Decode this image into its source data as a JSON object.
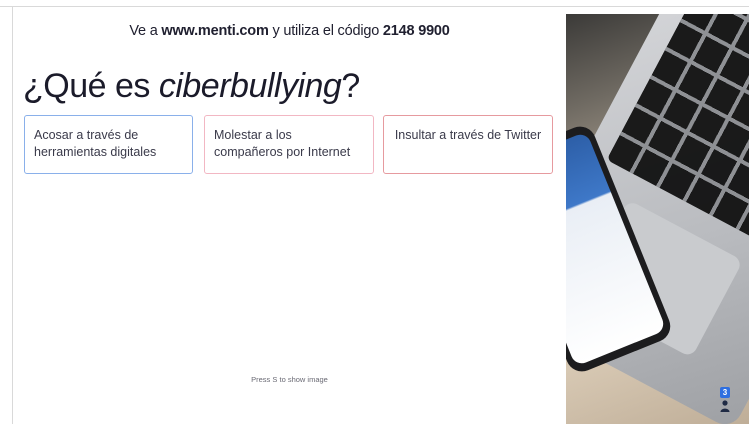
{
  "join": {
    "prefix": "Ve a ",
    "url": "www.menti.com",
    "middle": " y utiliza el código ",
    "code": "2148 9900"
  },
  "title": {
    "prefix": "¿Qué es ",
    "emphasis": "ciberbullying",
    "suffix": "?"
  },
  "options": [
    {
      "label": "Acosar a través de herramientas digitales",
      "color": "#8ab0ea"
    },
    {
      "label": "Molestar a los compañeros por Internet",
      "color": "#f2b7c3"
    },
    {
      "label": "Insultar a través de Twitter",
      "color": "#e69a9f"
    }
  ],
  "hint": "Press S to show image",
  "audience": {
    "count": "3"
  },
  "photo": {
    "icon": "laptop-photo-icon"
  }
}
